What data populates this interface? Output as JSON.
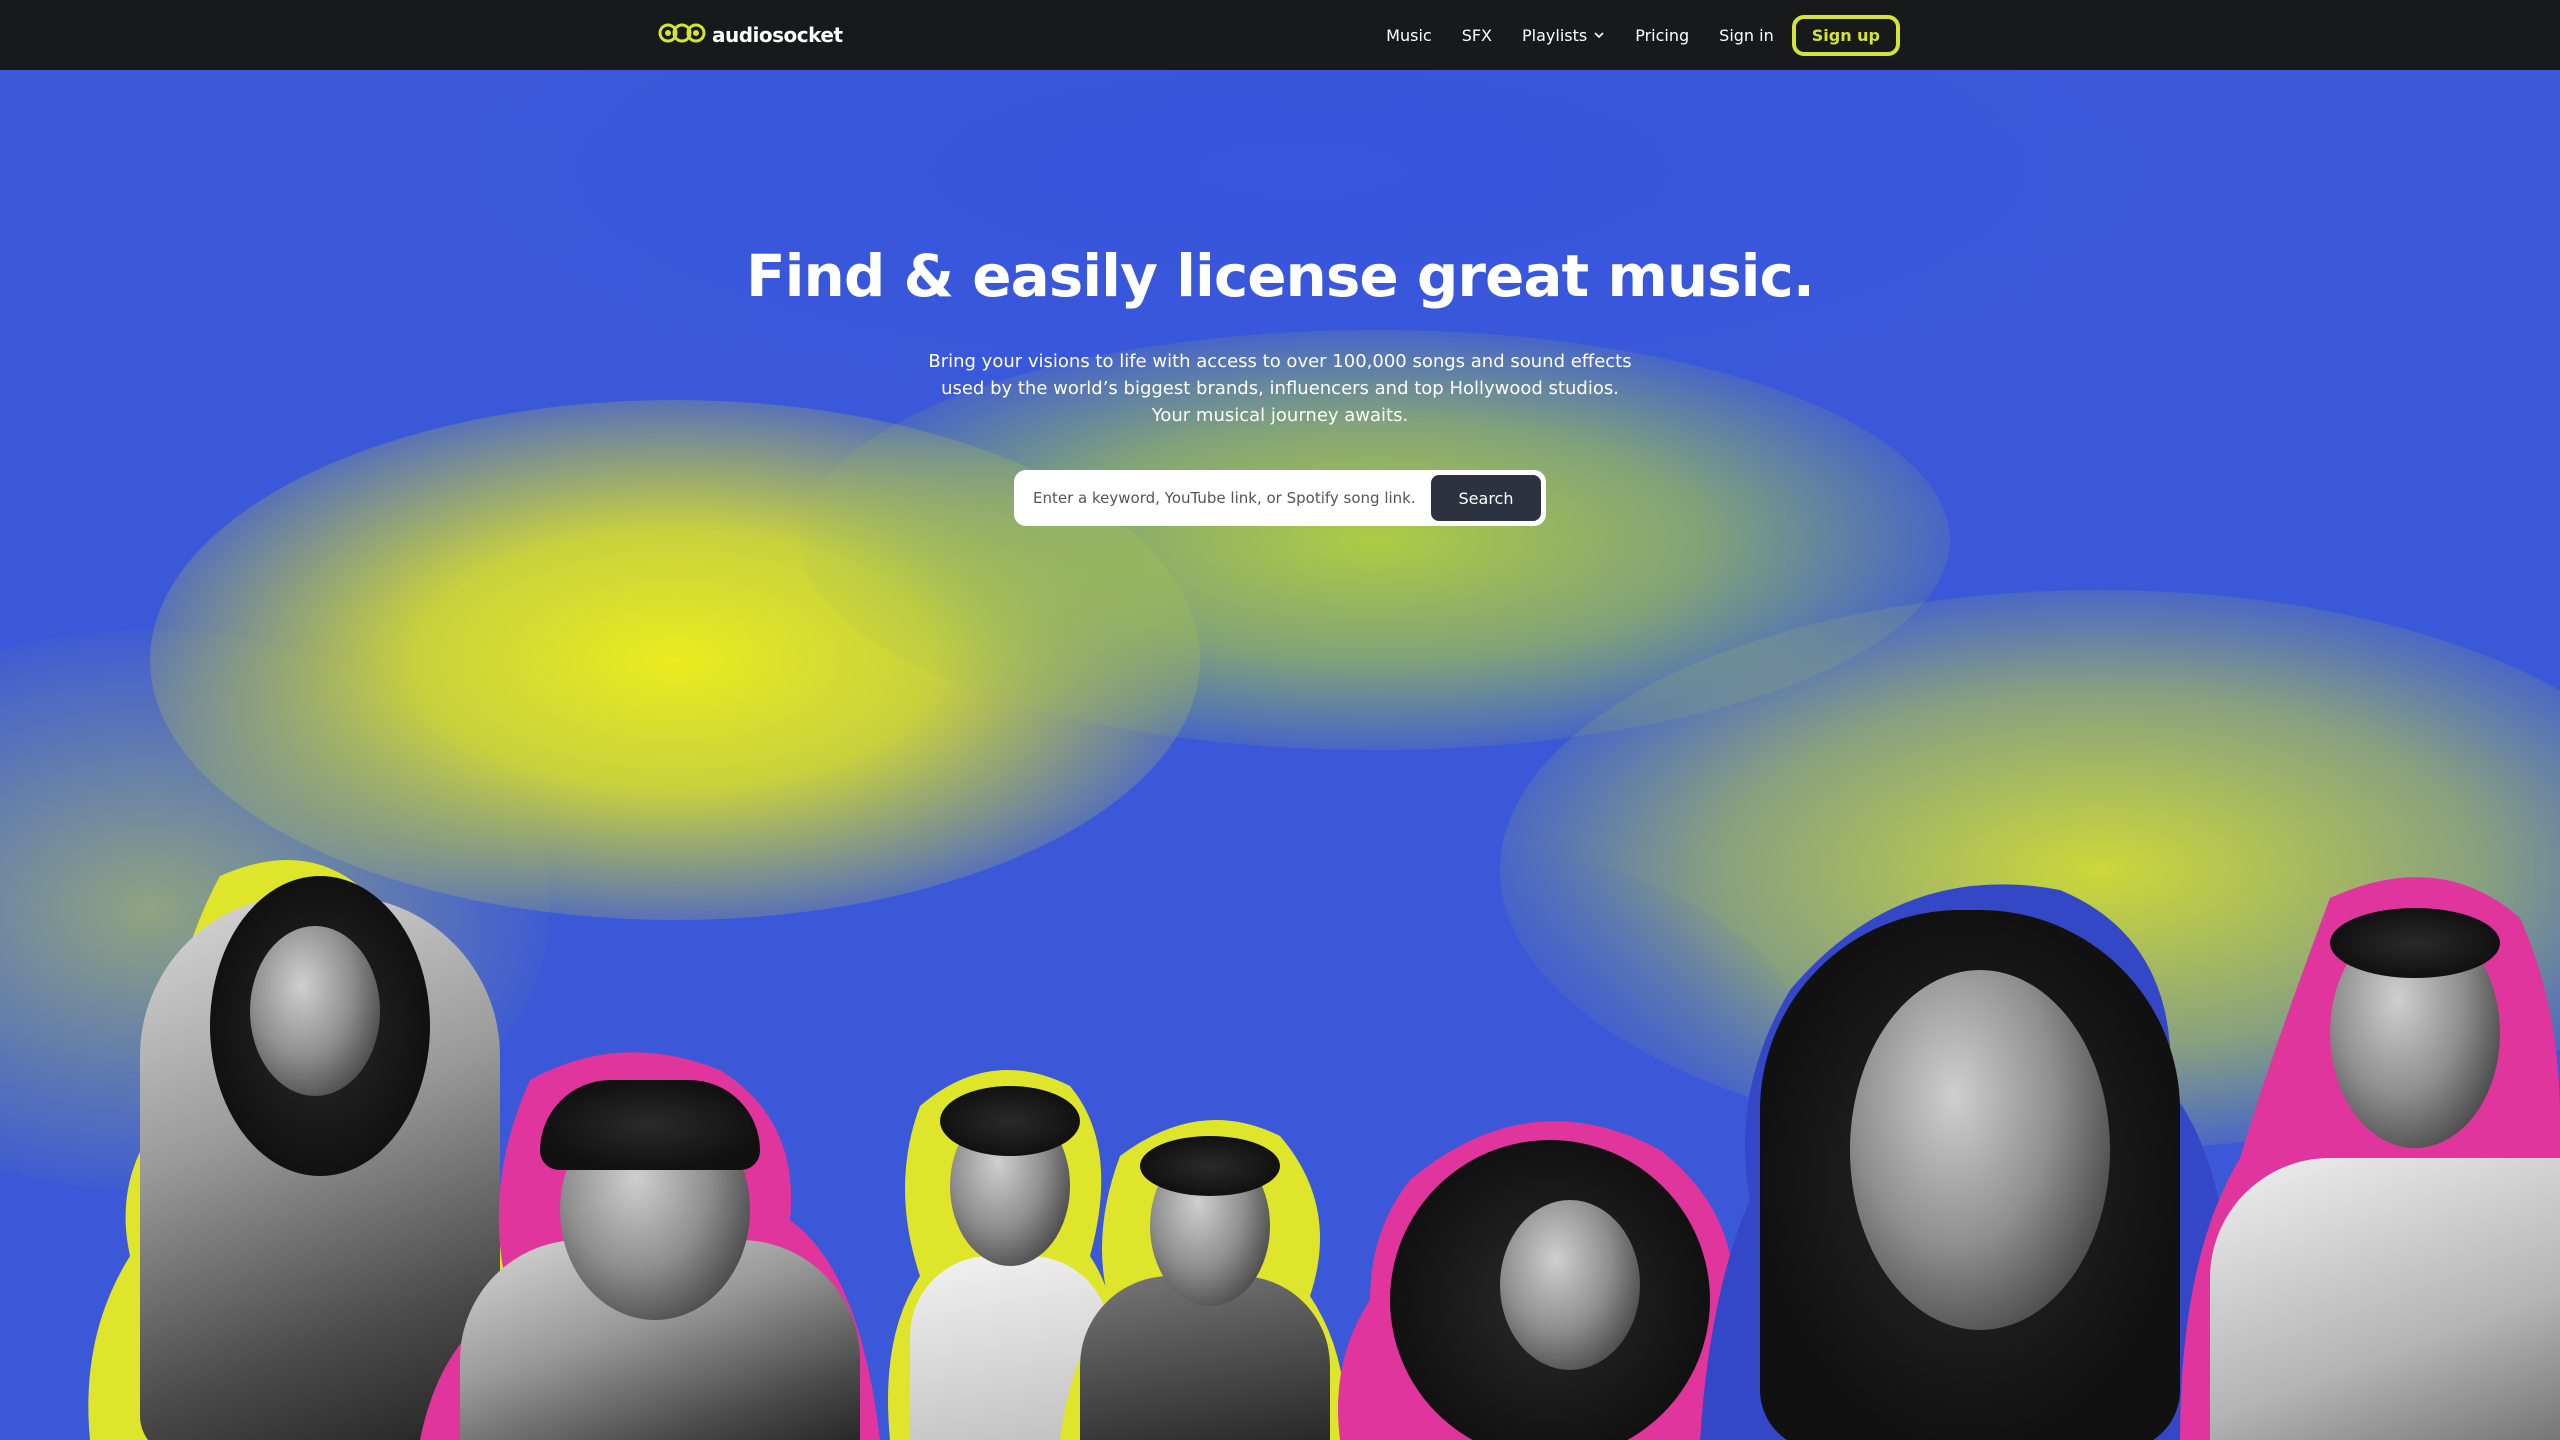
{
  "header": {
    "logo_text": "audiosocket",
    "nav": {
      "music": "Music",
      "sfx": "SFX",
      "playlists": "Playlists",
      "pricing": "Pricing",
      "sign_in": "Sign in",
      "sign_up": "Sign up"
    }
  },
  "hero": {
    "title": "Find & easily license great music.",
    "subtitle": "Bring your visions to life with access to over 100,000 songs and sound effects used by the world’s biggest brands, influencers and top Hollywood studios. Your musical journey awaits.",
    "search": {
      "placeholder": "Enter a keyword, YouTube link, or Spotify song link...",
      "value": "",
      "button_label": "Search"
    }
  },
  "colors": {
    "nav_bg": "#18191b",
    "accent_yellow": "#d4e436",
    "hero_blue": "#3a58d8",
    "outline_pink": "#e0359c",
    "outline_blue": "#3447c7"
  },
  "icons": {
    "logo": "audiosocket-logo-icon",
    "playlists_dropdown": "chevron-down-icon"
  }
}
